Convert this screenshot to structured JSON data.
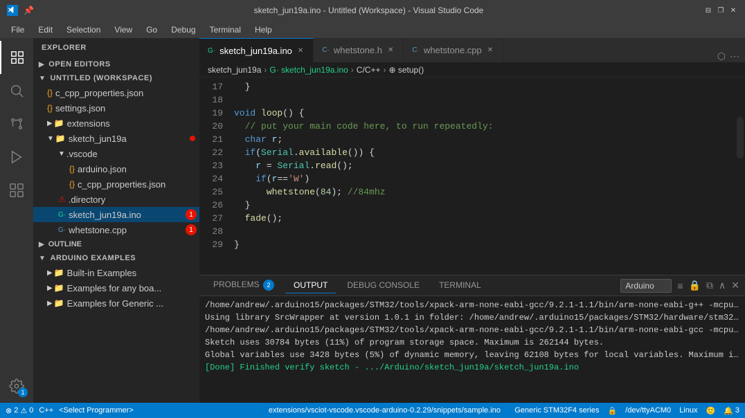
{
  "titlebar": {
    "title": "sketch_jun19a.ino - Untitled (Workspace) - Visual Studio Code",
    "window_controls": [
      "⊟",
      "❐",
      "✕"
    ]
  },
  "menubar": {
    "items": [
      "File",
      "Edit",
      "Selection",
      "View",
      "Go",
      "Debug",
      "Terminal",
      "Help"
    ]
  },
  "activitybar": {
    "items": [
      {
        "name": "explorer",
        "icon": "⧉",
        "active": true
      },
      {
        "name": "search",
        "icon": "🔍"
      },
      {
        "name": "source-control",
        "icon": "⎇"
      },
      {
        "name": "run",
        "icon": "▷"
      },
      {
        "name": "extensions",
        "icon": "⊞"
      }
    ],
    "bottom": [
      {
        "name": "settings",
        "icon": "⚙",
        "badge": "1"
      }
    ]
  },
  "sidebar": {
    "header": "Explorer",
    "sections": {
      "open_editors": {
        "label": "OPEN EDITORS",
        "collapsed": false
      },
      "workspace": {
        "label": "UNTITLED (WORKSPACE)",
        "items": [
          {
            "indent": 1,
            "icon": "{}",
            "label": "c_cpp_properties.json",
            "type": "file"
          },
          {
            "indent": 1,
            "icon": "{}",
            "label": "settings.json",
            "type": "file"
          },
          {
            "indent": 1,
            "icon": "▶",
            "label": "extensions",
            "type": "folder"
          },
          {
            "indent": 1,
            "icon": "▼",
            "label": "sketch_jun19a",
            "type": "folder",
            "dot": true
          },
          {
            "indent": 2,
            "icon": "▶",
            "label": ".vscode",
            "type": "folder"
          },
          {
            "indent": 3,
            "icon": "{}",
            "label": "arduino.json",
            "type": "file"
          },
          {
            "indent": 3,
            "icon": "{}",
            "label": "c_cpp_properties.json",
            "type": "file"
          },
          {
            "indent": 2,
            "icon": "⚠",
            "label": ".directory",
            "type": "file"
          },
          {
            "indent": 2,
            "icon": "G·",
            "label": "sketch_jun19a.ino",
            "type": "file-active",
            "badge": "1"
          },
          {
            "indent": 2,
            "icon": "G·",
            "label": "whetstone.cpp",
            "type": "file",
            "badge": "1"
          }
        ]
      },
      "outline": {
        "label": "OUTLINE"
      },
      "arduino_examples": {
        "label": "ARDUINO EXAMPLES",
        "items": [
          {
            "indent": 1,
            "icon": "📁",
            "label": "Built-in Examples"
          },
          {
            "indent": 1,
            "icon": "📁",
            "label": "Examples for any boa..."
          },
          {
            "indent": 1,
            "icon": "📁",
            "label": "Examples for Generic ..."
          }
        ]
      }
    }
  },
  "tabs": [
    {
      "label": "sketch_jun19a.ino",
      "icon": "G·",
      "color": "#23d18b",
      "active": true
    },
    {
      "label": "whetstone.h",
      "icon": "C·",
      "color": "#519aba",
      "active": false
    },
    {
      "label": "whetstone.cpp",
      "icon": "C·",
      "color": "#519aba",
      "active": false
    }
  ],
  "breadcrumb": {
    "parts": [
      "sketch_jun19a",
      "sketch_jun19a.ino",
      "C/C++",
      "setup()"
    ]
  },
  "code": {
    "lines": [
      {
        "num": 17,
        "content": "  }"
      },
      {
        "num": 18,
        "content": ""
      },
      {
        "num": 19,
        "content": "void loop() {"
      },
      {
        "num": 20,
        "content": "  // put your main code here, to run repeatedly:"
      },
      {
        "num": 21,
        "content": "  char r;"
      },
      {
        "num": 22,
        "content": "  if(Serial.available()) {"
      },
      {
        "num": 23,
        "content": "    r = Serial.read();"
      },
      {
        "num": 24,
        "content": "    if(r=='W')"
      },
      {
        "num": 25,
        "content": "      whetstone(84); //84mhz"
      },
      {
        "num": 26,
        "content": "  }"
      },
      {
        "num": 27,
        "content": "  fade();"
      },
      {
        "num": 28,
        "content": ""
      },
      {
        "num": 29,
        "content": "}"
      }
    ]
  },
  "panel": {
    "tabs": [
      {
        "label": "PROBLEMS",
        "badge": "2"
      },
      {
        "label": "OUTPUT",
        "active": true
      },
      {
        "label": "DEBUG CONSOLE"
      },
      {
        "label": "TERMINAL"
      }
    ],
    "arduino_select": "Arduino",
    "output_lines": [
      "/home/andrew/.arduino15/packages/STM32/tools/xpack-arm-none-eabi-gcc/9.2.1-1.1/bin/arm-none-eab...",
      "Using library SrcWrapper at version 1.0.1 in folder: /home/andrew/.arduino15/packages/STM32/ha...",
      "/home/andrew/.arduino15/packages/STM32/tools/xpack-arm-none-eabi-gcc/9.2.1-1.1/bin/arm-none-eab...",
      "Sketch uses 30784 bytes (11%) of program storage space. Maximum is 262144 bytes.",
      "Global variables use 3428 bytes (5%) of dynamic memory, leaving 62108 bytes for local variables...",
      "[Done] Finished verify sketch - .../Arduino/sketch_jun19a/sketch_jun19a.ino"
    ]
  },
  "statusbar": {
    "left": [
      {
        "icon": "⚠",
        "label": "2",
        "type": "error"
      },
      {
        "icon": "",
        "label": "0",
        "type": "warn"
      },
      {
        "label": "C++"
      },
      {
        "label": "<Select Programmer>"
      }
    ],
    "center": {
      "label": "extensions/vsciot-vscode.vscode-arduino-0.2.29/snippets/sample.ino"
    },
    "right": [
      {
        "label": "Generic STM32F4 series"
      },
      {
        "icon": "🔒",
        "label": ""
      },
      {
        "label": "/dev/ttyACM0"
      },
      {
        "label": "Linux"
      },
      {
        "icon": "😊",
        "label": ""
      },
      {
        "icon": "🔔",
        "label": "3"
      }
    ]
  }
}
